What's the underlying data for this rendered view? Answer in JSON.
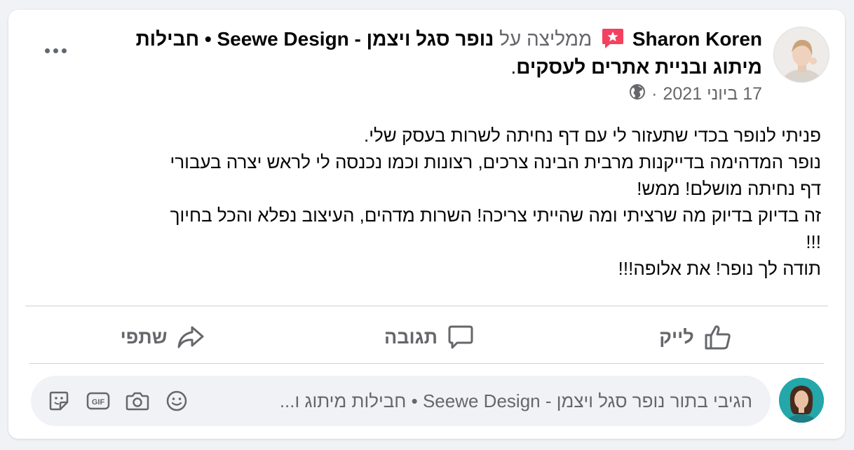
{
  "post": {
    "author": "Sharon Koren",
    "recommends_word": "ממליצה על",
    "page_name_part1": "נופר סגל ויצמן - Seewe Design • חבילות",
    "page_name_part2": "מיתוג ובניית אתרים לעסקים",
    "period": ".",
    "date": "17 ביוני 2021",
    "dot_separator": "·",
    "body_lines": [
      "פניתי לנופר בכדי שתעזור לי עם דף נחיתה לשרות בעסק שלי.",
      "נופר המדהימה בדייקנות מרבית הבינה צרכים, רצונות וכמו נכנסה לי לראש יצרה בעבורי",
      "דף נחיתה מושלם! ממש!",
      "זה בדיוק בדיוק מה שרציתי ומה שהייתי צריכה! השרות מדהים, העיצוב נפלא והכל בחיוך",
      "!!!",
      "תודה לך נופר! את אלופה!!!"
    ]
  },
  "actions": {
    "like_label": "לייק",
    "comment_label": "תגובה",
    "share_label": "שתפי"
  },
  "comment": {
    "placeholder": "הגיבי בתור נופר סגל ויצמן - Seewe Design • חבילות מיתוג ו..."
  },
  "icons": {
    "more": "more-horizontal-icon",
    "recommend": "recommend-badge-icon",
    "privacy": "globe-icon",
    "like": "thumbs-up-icon",
    "comment": "speech-bubble-icon",
    "share": "share-arrow-icon",
    "emoji": "smiley-icon",
    "camera": "camera-icon",
    "gif": "gif-icon",
    "sticker": "sticker-icon"
  },
  "colors": {
    "recommend_badge": "#f3425f",
    "secondary_text": "#65676b",
    "card_bg": "#ffffff",
    "page_bg": "#f0f2f5"
  }
}
